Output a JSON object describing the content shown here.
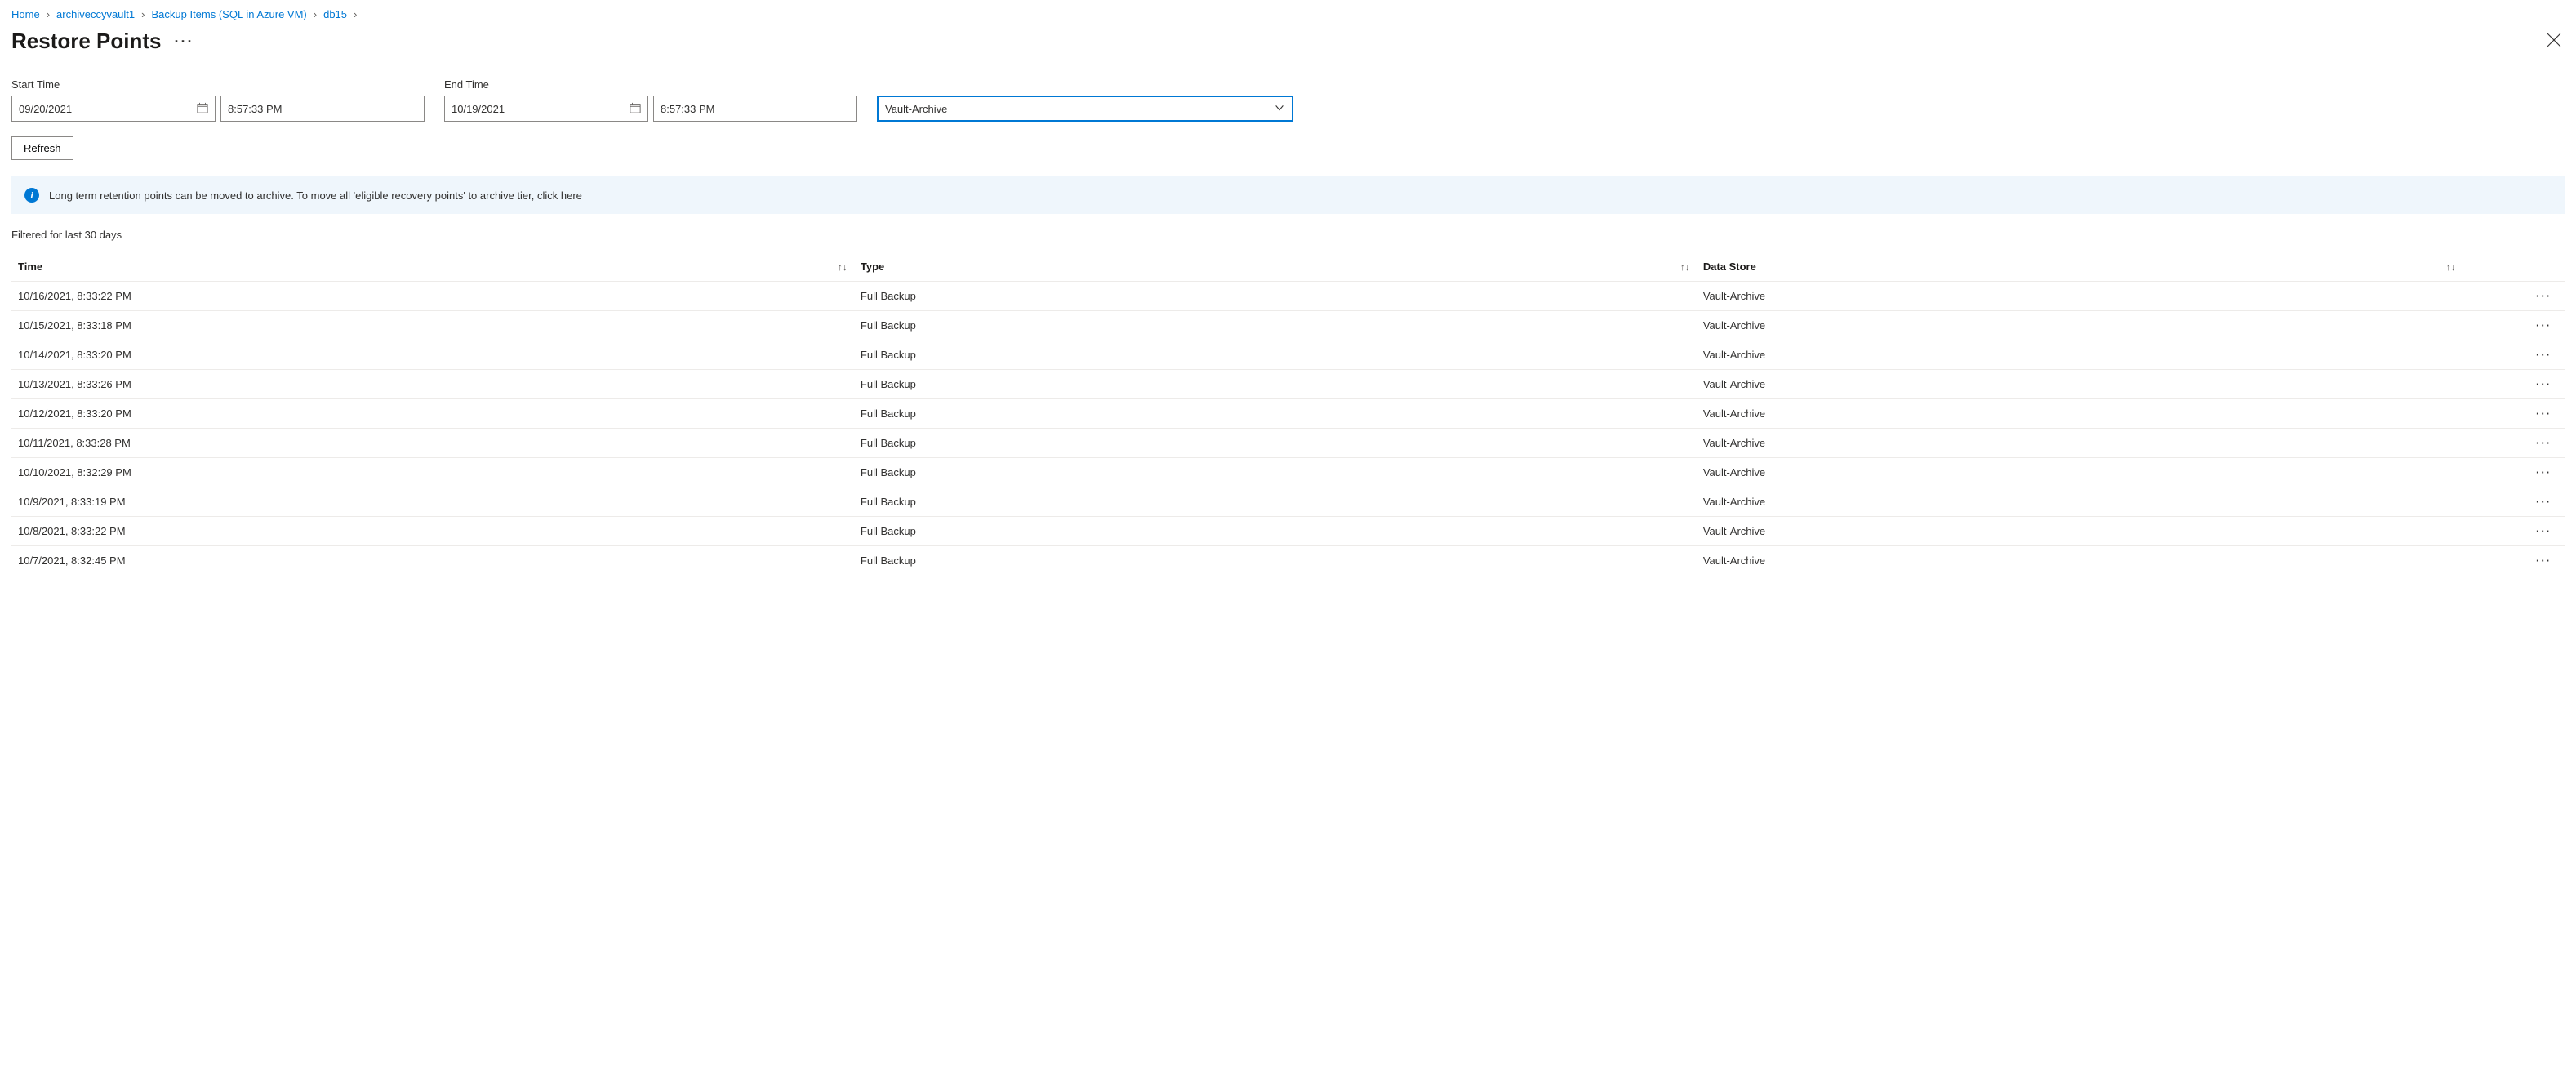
{
  "breadcrumb": [
    {
      "label": "Home"
    },
    {
      "label": "archiveccyvault1"
    },
    {
      "label": "Backup Items (SQL in Azure VM)"
    },
    {
      "label": "db15"
    }
  ],
  "page": {
    "title": "Restore Points",
    "more": "···"
  },
  "filters": {
    "start_label": "Start Time",
    "start_date": "09/20/2021",
    "start_time": "8:57:33 PM",
    "end_label": "End Time",
    "end_date": "10/19/2021",
    "end_time": "8:57:33 PM",
    "tier_dropdown": "Vault-Archive"
  },
  "buttons": {
    "refresh": "Refresh"
  },
  "banner": {
    "text": "Long term retention points can be moved to archive. To move all 'eligible recovery points' to archive tier, click here"
  },
  "filter_status": "Filtered for last 30 days",
  "table": {
    "headers": {
      "time": "Time",
      "type": "Type",
      "store": "Data Store"
    },
    "rows": [
      {
        "time": "10/16/2021, 8:33:22 PM",
        "type": "Full Backup",
        "store": "Vault-Archive"
      },
      {
        "time": "10/15/2021, 8:33:18 PM",
        "type": "Full Backup",
        "store": "Vault-Archive"
      },
      {
        "time": "10/14/2021, 8:33:20 PM",
        "type": "Full Backup",
        "store": "Vault-Archive"
      },
      {
        "time": "10/13/2021, 8:33:26 PM",
        "type": "Full Backup",
        "store": "Vault-Archive"
      },
      {
        "time": "10/12/2021, 8:33:20 PM",
        "type": "Full Backup",
        "store": "Vault-Archive"
      },
      {
        "time": "10/11/2021, 8:33:28 PM",
        "type": "Full Backup",
        "store": "Vault-Archive"
      },
      {
        "time": "10/10/2021, 8:32:29 PM",
        "type": "Full Backup",
        "store": "Vault-Archive"
      },
      {
        "time": "10/9/2021, 8:33:19 PM",
        "type": "Full Backup",
        "store": "Vault-Archive"
      },
      {
        "time": "10/8/2021, 8:33:22 PM",
        "type": "Full Backup",
        "store": "Vault-Archive"
      },
      {
        "time": "10/7/2021, 8:32:45 PM",
        "type": "Full Backup",
        "store": "Vault-Archive"
      }
    ],
    "row_action": "···"
  }
}
